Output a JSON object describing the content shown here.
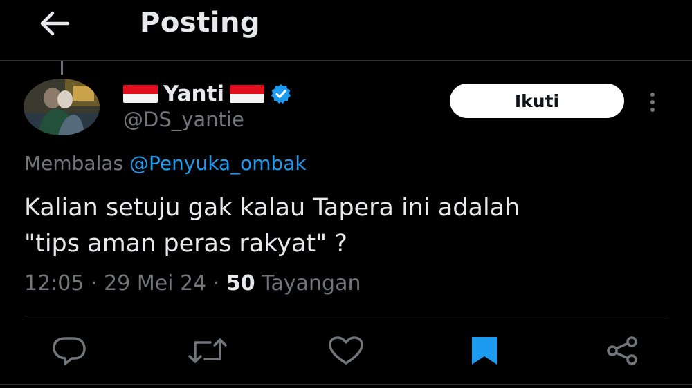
{
  "header": {
    "title": "Posting",
    "back_icon": "arrow-left-icon"
  },
  "author": {
    "display_name": "Yanti",
    "handle": "@DS_yantie",
    "flag": "indonesia-flag",
    "verified": true,
    "verified_color": "#1d9bf0"
  },
  "follow_button": {
    "label": "Ikuti"
  },
  "more_icon": "more-vertical-icon",
  "reply": {
    "prefix": "Membalas",
    "mention": "@Penyuka_ombak"
  },
  "tweet": {
    "line1": "Kalian setuju gak kalau Tapera ini adalah",
    "line2": "\"tips aman peras rakyat\" ?"
  },
  "meta": {
    "time": "12:05",
    "date": "29 Mei 24",
    "separator": "·",
    "views_count": "50",
    "views_label": "Tayangan"
  },
  "actions": [
    {
      "icon": "reply-icon"
    },
    {
      "icon": "retweet-icon"
    },
    {
      "icon": "like-icon"
    },
    {
      "icon": "bookmark-icon",
      "active": true,
      "color": "#1d9bf0"
    },
    {
      "icon": "share-icon"
    }
  ],
  "colors": {
    "background": "#000000",
    "text": "#e7e9ea",
    "muted": "#71767b",
    "accent": "#1d9bf0"
  }
}
